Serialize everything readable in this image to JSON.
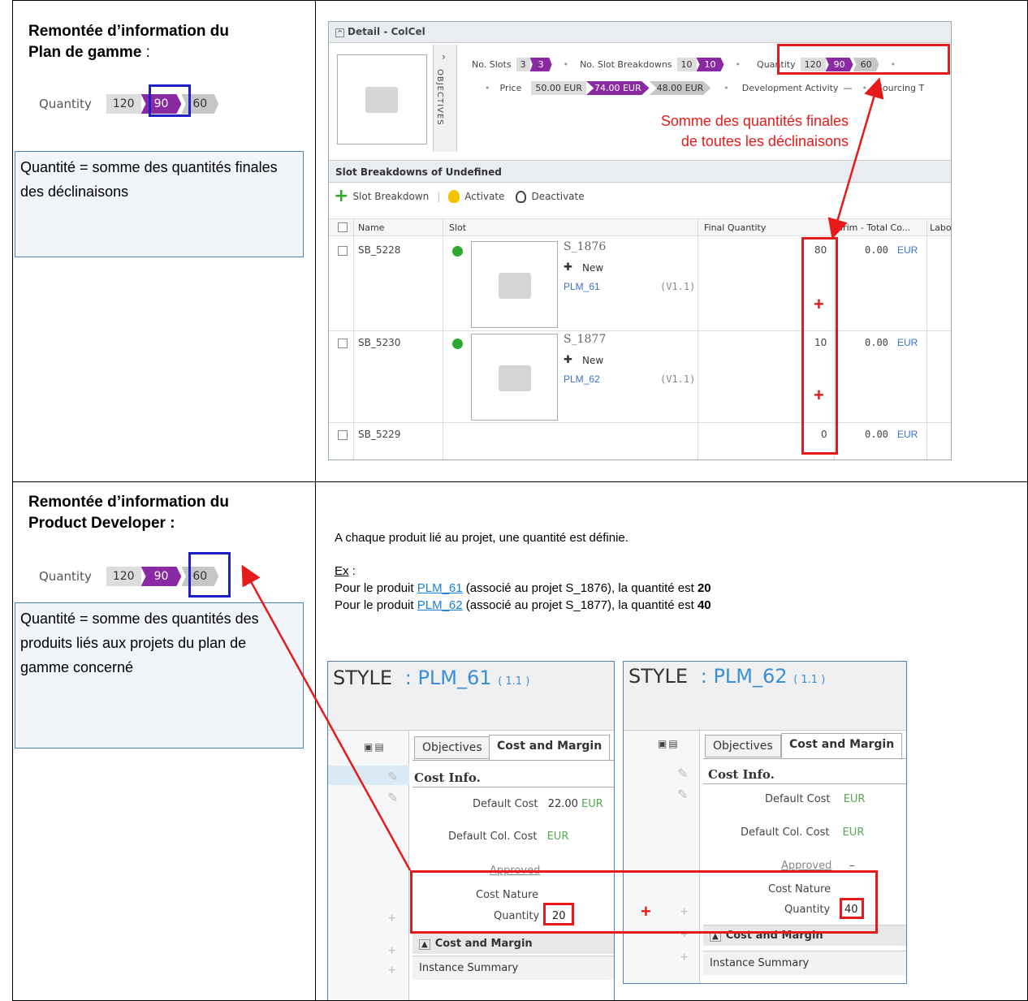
{
  "left_top": {
    "title_line1": "Remontée d’information du",
    "title_bold2": "Plan de gamme",
    "title_colon": " :",
    "qty_label": "Quantity",
    "chip1": "120",
    "chip2": "90",
    "chip3": "60",
    "note": "Quantité = somme des quantités finales des déclinaisons"
  },
  "detail": {
    "header": "Detail - ColCel",
    "objectives_label": "OBJECTIVES",
    "no_slots_label": "No. Slots",
    "no_slots_a": "3",
    "no_slots_b": "3",
    "no_sb_label": "No. Slot Breakdowns",
    "no_sb_a": "10",
    "no_sb_b": "10",
    "qty_label": "Quantity",
    "qty_a": "120",
    "qty_b": "90",
    "qty_c": "60",
    "price_label": "Price",
    "price_a": "50.00 EUR",
    "price_b": "74.00 EUR",
    "price_c": "48.00 EUR",
    "dev_label": "Development Activity",
    "dev_value": "—",
    "sourcing_label": "Sourcing T",
    "annotation_line1": "Somme des quantités finales",
    "annotation_line2": "de toutes les déclinaisons",
    "section_title": "Slot Breakdowns of Undefined",
    "btn_slot_breakdown": "Slot Breakdown",
    "btn_activate": "Activate",
    "btn_deactivate": "Deactivate",
    "col_name": "Name",
    "col_slot": "Slot",
    "col_final_qty": "Final Quantity",
    "col_trim": "Trim - Total Co...",
    "col_labor": "Labo",
    "rows": [
      {
        "name": "SB_5228",
        "slot": "S_1876",
        "status": "New",
        "plm": "PLM_61",
        "version": "(V1.1)",
        "qty": "80",
        "trim": "0.00",
        "cur": "EUR"
      },
      {
        "name": "SB_5230",
        "slot": "S_1877",
        "status": "New",
        "plm": "PLM_62",
        "version": "(V1.1)",
        "qty": "10",
        "trim": "0.00",
        "cur": "EUR"
      },
      {
        "name": "SB_5229",
        "qty": "0",
        "trim": "0.00",
        "cur": "EUR"
      }
    ]
  },
  "left_bottom": {
    "title_line1": "Remontée d’information du",
    "title_line2": "Product Developer :",
    "qty_label": "Quantity",
    "chip1": "120",
    "chip2": "90",
    "chip3": "60",
    "note": "Quantité = somme des quantités des produits liés aux projets du plan de gamme concerné"
  },
  "right_bottom": {
    "intro": "A chaque produit lié au projet, une quantité est définie.",
    "ex": "Ex",
    "ex_colon": " :",
    "line1_pre": "Pour le produit ",
    "line1_link": "PLM_61",
    "line1_mid": " (associé au projet S_1876), la quantité est ",
    "line1_val": "20",
    "line2_pre": "Pour le produit ",
    "line2_link": "PLM_62",
    "line2_mid": " (associé au projet S_1877), la quantité est ",
    "line2_val": "40"
  },
  "style1": {
    "title": "STYLE",
    "code": ": PLM_61",
    "version": "( 1.1 )",
    "tab1": "Objectives",
    "tab2": "Cost and Margin",
    "section": "Cost Info.",
    "default_cost_label": "Default Cost",
    "default_cost_value": "22.00",
    "default_cost_cur": "EUR",
    "default_col_cost_label": "Default Col. Cost",
    "default_col_cost_cur": "EUR",
    "approved_label": "Approved",
    "cost_nature_label": "Cost Nature",
    "quantity_label": "Quantity",
    "quantity_value": "20",
    "cm_section": "Cost and Margin",
    "instance_summary": "Instance Summary"
  },
  "style2": {
    "title": "STYLE",
    "code": ": PLM_62",
    "version": "( 1.1 )",
    "tab1": "Objectives",
    "tab2": "Cost and Margin",
    "section": "Cost Info.",
    "default_cost_label": "Default Cost",
    "default_cost_cur": "EUR",
    "default_col_cost_label": "Default Col. Cost",
    "default_col_cost_cur": "EUR",
    "approved_label": "Approved",
    "approved_value": "–",
    "cost_nature_label": "Cost Nature",
    "quantity_label": "Quantity",
    "quantity_value": "40",
    "cm_section": "Cost and Margin",
    "instance_summary": "Instance Summary"
  },
  "plus_sign": "+",
  "colors": {
    "purple": "#8a2aa3",
    "red": "#e61a1a",
    "blue_box": "#1f1fc8",
    "link": "#3a72c8"
  }
}
